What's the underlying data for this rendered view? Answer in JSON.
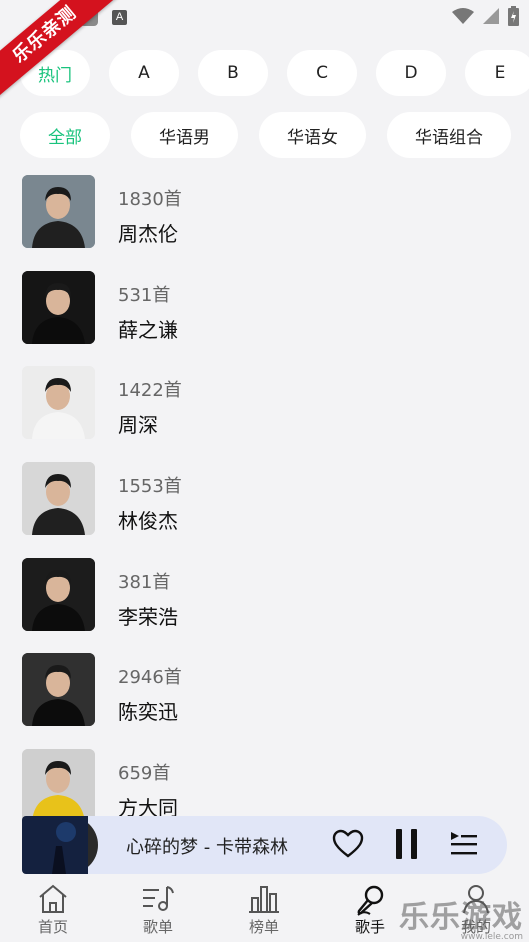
{
  "status": {
    "a_glyph": "A"
  },
  "ribbon": {
    "text": "乐乐亲测"
  },
  "letter_chips": [
    {
      "label": "热门",
      "active": true
    },
    {
      "label": "A",
      "active": false
    },
    {
      "label": "B",
      "active": false
    },
    {
      "label": "C",
      "active": false
    },
    {
      "label": "D",
      "active": false
    },
    {
      "label": "E",
      "active": false
    }
  ],
  "category_chips": [
    {
      "label": "全部",
      "active": true
    },
    {
      "label": "华语男",
      "active": false
    },
    {
      "label": "华语女",
      "active": false
    },
    {
      "label": "华语组合",
      "active": false
    }
  ],
  "artists": [
    {
      "count": "1830首",
      "name": "周杰伦",
      "bg": "#7a8790"
    },
    {
      "count": "531首",
      "name": "薛之谦",
      "bg": "#151515"
    },
    {
      "count": "1422首",
      "name": "周深",
      "bg": "#ececec"
    },
    {
      "count": "1553首",
      "name": "林俊杰",
      "bg": "#d7d7d7"
    },
    {
      "count": "381首",
      "name": "李荣浩",
      "bg": "#1c1c1c"
    },
    {
      "count": "2946首",
      "name": "陈奕迅",
      "bg": "#303030"
    },
    {
      "count": "659首",
      "name": "方大同",
      "bg": "#cfcfcf"
    }
  ],
  "player": {
    "song": "心碎的梦 - 卡带森林",
    "cover_text": "心碎的梦"
  },
  "tabs": [
    {
      "label": "首页",
      "icon": "home-icon",
      "active": false
    },
    {
      "label": "歌单",
      "icon": "playlist-icon",
      "active": false
    },
    {
      "label": "榜单",
      "icon": "chart-icon",
      "active": false
    },
    {
      "label": "歌手",
      "icon": "microphone-icon",
      "active": true
    },
    {
      "label": "我的",
      "icon": "user-icon",
      "active": false
    }
  ],
  "watermark": {
    "text": "乐乐游戏",
    "sub": "www.lele.com"
  }
}
